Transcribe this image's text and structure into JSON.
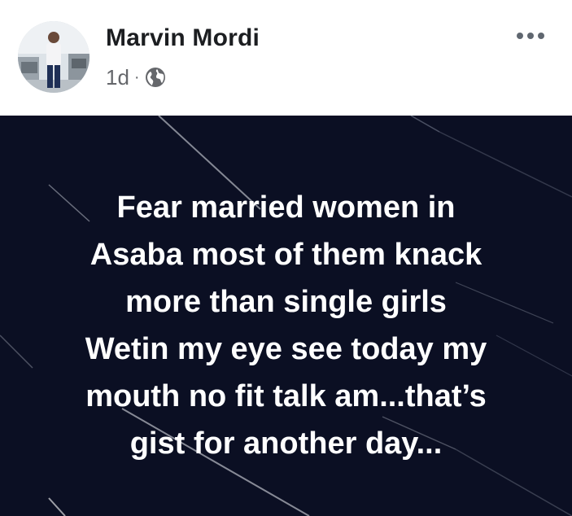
{
  "post": {
    "author": {
      "name": "Marvin Mordi",
      "avatar_icon": "profile-photo"
    },
    "meta": {
      "time": "1d",
      "separator": "·",
      "privacy_icon": "globe-icon"
    },
    "more_icon": "ellipsis-icon",
    "body": {
      "background_color": "#0b0f23",
      "text_color": "#ffffff",
      "lines": [
        "Fear married women in",
        "Asaba most of them knack",
        "more than single girls",
        "Wetin my eye see today my",
        "mouth no fit talk am...that’s",
        "gist for another day..."
      ]
    }
  }
}
